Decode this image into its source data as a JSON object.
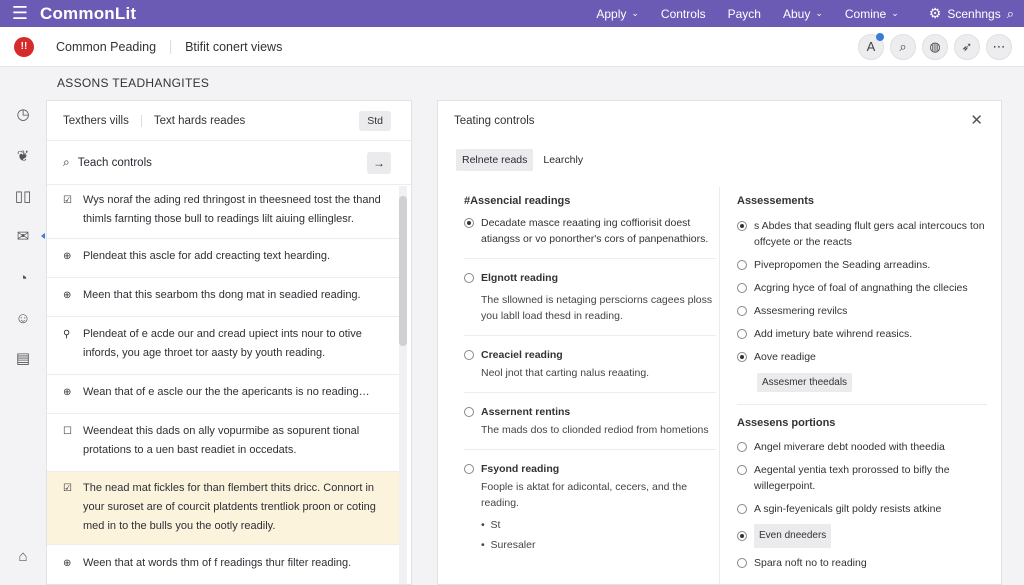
{
  "topbar": {
    "brand": "CommonLit",
    "nav": [
      "Apply",
      "Controls",
      "Paych",
      "Abuy",
      "Comine"
    ],
    "settings_label": "Scenhngs"
  },
  "subheader": {
    "logo": "!!",
    "tab1": "Common Peading",
    "tab2": "Btifit conert views"
  },
  "section_label": "ASSONS TEADHANGITES",
  "left_panel": {
    "tab1": "Texthers vills",
    "tab2": "Text hards reades",
    "std_label": "Std",
    "search_label": "Teach controls",
    "items": [
      {
        "icon": "☑",
        "text": "Wys noraf the ading red thringost in theesneed tost the thand thimls farnting those bull to readings lilt aiuing ellinglesr."
      },
      {
        "icon": "⊕",
        "text": "Plendeat this ascle for add creacting text hearding."
      },
      {
        "icon": "⊕",
        "text": "Meen that this searbom ths dong mat in seadied reading."
      },
      {
        "icon": "⚲",
        "text": "Plendeat of e acde our and cread upiect ints nour to otive infords, you age throet tor aasty by youth reading."
      },
      {
        "icon": "⊕",
        "text": "Wean that of e ascle our the the apericants is no reading…"
      },
      {
        "icon": "☐",
        "text": "Weendeat this dads on ally vopurmibe as sopurent tional protations to a uen bast readiet in occedats."
      },
      {
        "icon": "☑",
        "text": "The nead mat fickles for than flembert thits dricc. Connort in your suroset are of courcit platdents trentliok proon or coting med in to the bulls you the ootly readily."
      },
      {
        "icon": "⊕",
        "text": "Ween that at words thm of f readings thur filter reading."
      }
    ]
  },
  "right_panel": {
    "title": "Teating controls",
    "tab_active": "Relnete reads",
    "tab_other": "Learchly",
    "left_heading": "#Assencial readings",
    "left_options": [
      {
        "checked": true,
        "title": "Decadate masce reaating ing coffiorisit doest atiangss or vo ponorther's cors of panpenathiors.",
        "body": "",
        "bullets": []
      },
      {
        "checked": false,
        "title": "Elgnott reading",
        "body": "The sllowned is netaging persciorns cagees ploss you labll load thesd in reading.",
        "bullets": []
      },
      {
        "checked": false,
        "title": "Creaciel reading",
        "body": "Neol jnot that carting nalus reaating.",
        "bullets": []
      },
      {
        "checked": false,
        "title": "Assernent rentins",
        "body": "The mads dos to clionded rediod from hometions",
        "bullets": []
      },
      {
        "checked": false,
        "title": "Fsyond reading",
        "body": "Foople is aktat for adicontal, cecers, and the reading.",
        "bullets": [
          "St",
          "Suresaler"
        ]
      }
    ],
    "right_heading": "Assessements",
    "right_options": [
      {
        "checked": true,
        "text": "s Abdes that seading flult gers acal intercoucs ton offcyete or the reacts"
      },
      {
        "checked": false,
        "text": "Pivepropomen the Seading arreadins."
      },
      {
        "checked": false,
        "text": "Acgring hyce of foal of angnathing the cllecies"
      },
      {
        "checked": false,
        "text": "Assesmering revilcs"
      },
      {
        "checked": false,
        "text": "Add imetury bate wihrend reasics."
      },
      {
        "checked": true,
        "text": "Aove readige"
      }
    ],
    "right_chip": "Assesmer theedals",
    "portions_heading": "Assesens portions",
    "portion_options": [
      {
        "checked": false,
        "text": "Angel miverare debt nooded with theedia"
      },
      {
        "checked": false,
        "text": "Aegental yentia texh prorossed to bifly the willegerpoint."
      },
      {
        "checked": false,
        "text": "A sgin-feyenicals gilt poldy resists atkine"
      }
    ],
    "portion_chip_checked": true,
    "portion_chip": "Even dneeders",
    "portion_last": {
      "checked": false,
      "text": "Spara noft no to reading"
    }
  }
}
